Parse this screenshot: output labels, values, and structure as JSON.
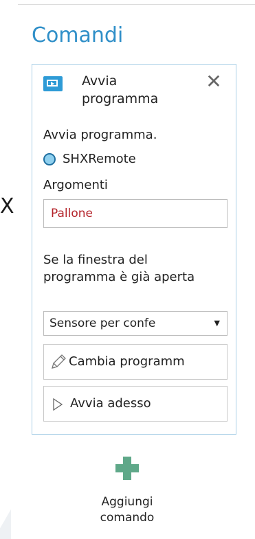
{
  "section_title": "Comandi",
  "command": {
    "title": "Avvia programma",
    "description": "Avvia programma.",
    "program_name": "SHXRemote",
    "arguments_label": "Argomenti",
    "arguments_value": "Pallone",
    "window_open_label": "Se la finestra del programma è già aperta",
    "window_open_selected": "Sensore per confe",
    "change_program_label": "Cambia programm",
    "run_now_label": "Avvia adesso"
  },
  "add_command_label": "Aggiungi comando",
  "left_edge_glyph": "X",
  "colors": {
    "accent": "#2f8fc8",
    "icon_blue": "#2e9bd6",
    "panel_border": "#a9cfe6",
    "add_green": "#5fa889",
    "input_text": "#b4232a"
  },
  "icons": {
    "program": "program-window-icon",
    "close": "close-icon",
    "radio": "radio-selected-icon",
    "dropdown": "chevron-down-icon",
    "change": "pencil-icon",
    "run": "play-icon",
    "add": "plus-icon"
  }
}
